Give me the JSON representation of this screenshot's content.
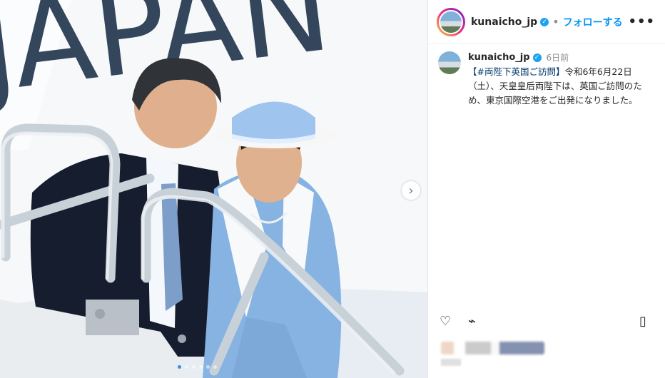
{
  "account": {
    "username": "kunaicho_jp",
    "follow_label": "フォローする",
    "more_label": "•••"
  },
  "caption": {
    "username": "kunaicho_jp",
    "time": "6日前",
    "hashtag": "【#両陛下英国ご訪問】",
    "text": "令和6年6月22日（土）、天皇皇后両陛下は、英国ご訪問のため、東京国際空港をご出発になりました。"
  },
  "media": {
    "plane_text": "JAPAN",
    "carousel_dots": 6
  }
}
